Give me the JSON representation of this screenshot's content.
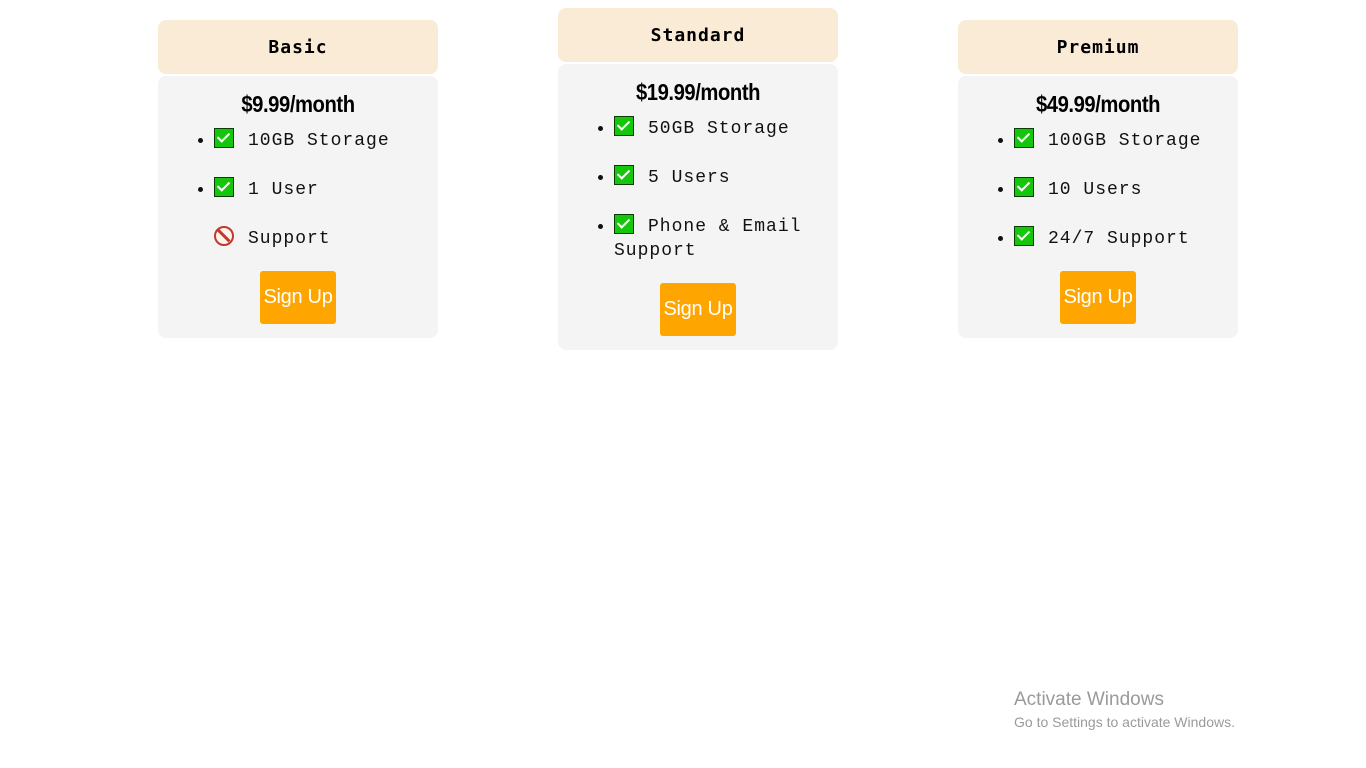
{
  "plans": [
    {
      "name": "Basic",
      "price": "$9.99/month",
      "features": [
        {
          "icon": "check-icon",
          "text": "10GB Storage",
          "included": true
        },
        {
          "icon": "check-icon",
          "text": "1 User",
          "included": true
        },
        {
          "icon": "prohibited-icon",
          "text": "Support",
          "included": false
        }
      ],
      "button_label": "Sign Up"
    },
    {
      "name": "Standard",
      "price": "$19.99/month",
      "features": [
        {
          "icon": "check-icon",
          "text": "50GB Storage",
          "included": true
        },
        {
          "icon": "check-icon",
          "text": "5 Users",
          "included": true
        },
        {
          "icon": "check-icon",
          "text": "Phone & Email Support",
          "included": true
        }
      ],
      "button_label": "Sign Up"
    },
    {
      "name": "Premium",
      "price": "$49.99/month",
      "features": [
        {
          "icon": "check-icon",
          "text": "100GB Storage",
          "included": true
        },
        {
          "icon": "check-icon",
          "text": "10 Users",
          "included": true
        },
        {
          "icon": "check-icon",
          "text": "24/7 Support",
          "included": true
        }
      ],
      "button_label": "Sign Up"
    }
  ],
  "watermark": {
    "title": "Activate Windows",
    "subtitle": "Go to Settings to activate Windows."
  },
  "colors": {
    "header_bg": "#faebd7",
    "card_bg": "#f4f4f4",
    "button_bg": "#ffa500",
    "check_green": "#16c60c"
  }
}
